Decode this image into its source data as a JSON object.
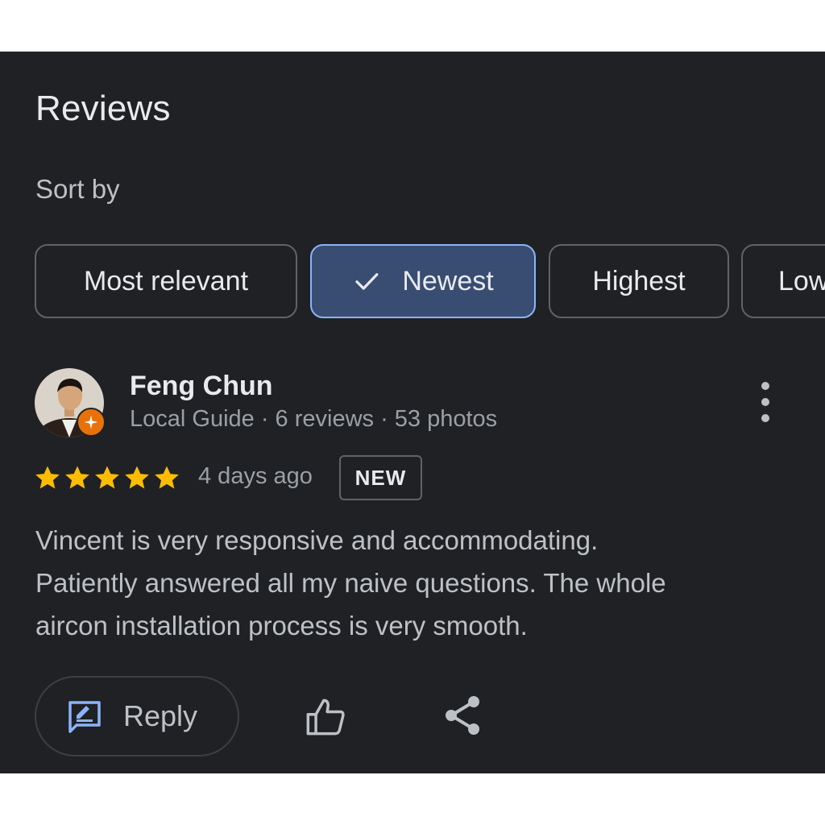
{
  "header": {
    "title": "Reviews",
    "sort_label": "Sort by"
  },
  "sort_chips": [
    {
      "label": "Most relevant",
      "selected": false
    },
    {
      "label": "Newest",
      "selected": true
    },
    {
      "label": "Highest",
      "selected": false
    },
    {
      "label": "Lowest",
      "selected": false
    }
  ],
  "review": {
    "author": "Feng Chun",
    "meta": "Local Guide · 6 reviews · 53 photos",
    "rating": 5,
    "date": "4 days ago",
    "tag": "NEW",
    "text_lines": [
      "Vincent is very responsive and accommodating.",
      "Patiently answered all my naive questions. The whole",
      "aircon installation process is very smooth."
    ]
  },
  "actions": {
    "reply_label": "Reply"
  },
  "colors": {
    "background": "#202124",
    "selected_chip": "#394d73",
    "accent_blue": "#8ab4f8",
    "star": "#fbbc04",
    "local_guide_badge": "#e8710a"
  }
}
